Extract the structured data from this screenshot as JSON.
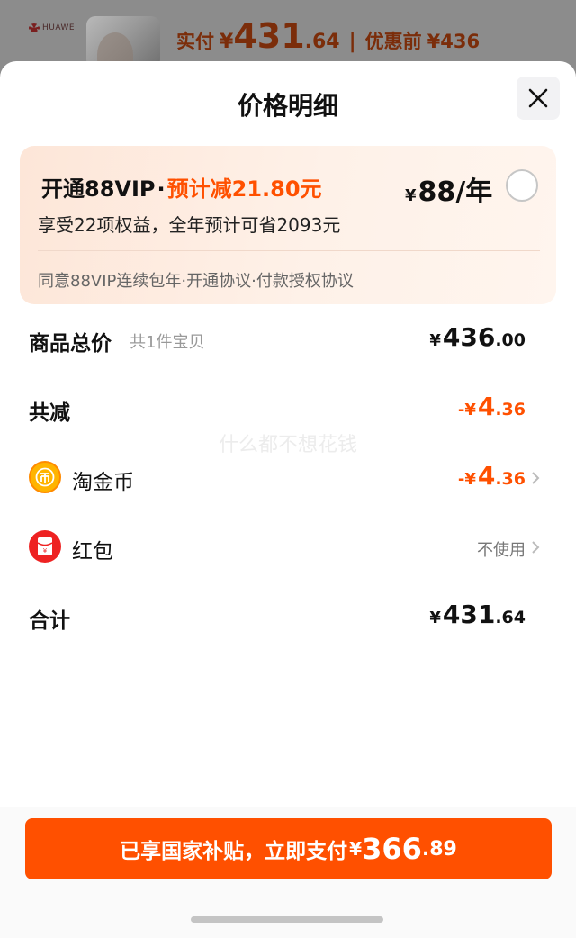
{
  "background": {
    "brand": "HUAWEI",
    "actual_label": "实付",
    "currency": "¥",
    "actual_int": "431",
    "actual_dec": ".64",
    "separator": "|",
    "original_label": "优惠前",
    "original_price": "¥436"
  },
  "sheet": {
    "title": "价格明细",
    "close_icon": "close-icon"
  },
  "vip": {
    "open_label": "开通88VIP",
    "dot": "·",
    "save_label": "预计减21.80元",
    "currency": "¥",
    "price": "88/年",
    "benefit": "享受22项权益，全年预计可省2093元",
    "agreement": "同意88VIP连续包年·开通协议·付款授权协议"
  },
  "rows": {
    "total": {
      "label": "商品总价",
      "sub": "共1件宝贝",
      "currency": "¥",
      "int": "436",
      "dec": ".00"
    },
    "discount": {
      "label": "共减",
      "prefix": "-¥",
      "int": "4",
      "dec": ".36"
    },
    "coins": {
      "label": "淘金币",
      "icon": "coin-icon",
      "prefix": "-¥",
      "int": "4",
      "dec": ".36"
    },
    "hongbao": {
      "label": "红包",
      "icon": "red-envelope-icon",
      "value": "不使用"
    },
    "sum": {
      "label": "合计",
      "currency": "¥",
      "int": "431",
      "dec": ".64"
    }
  },
  "watermark": "什么都不想花钱",
  "pay_button": {
    "text": "已享国家补贴，立即支付",
    "currency": "¥",
    "int": "366",
    "dec": ".89"
  },
  "colors": {
    "accent": "#ff5000",
    "vip_card_bg": "#fde6d8",
    "coin": "#ffb400",
    "hongbao": "#ee2222"
  }
}
